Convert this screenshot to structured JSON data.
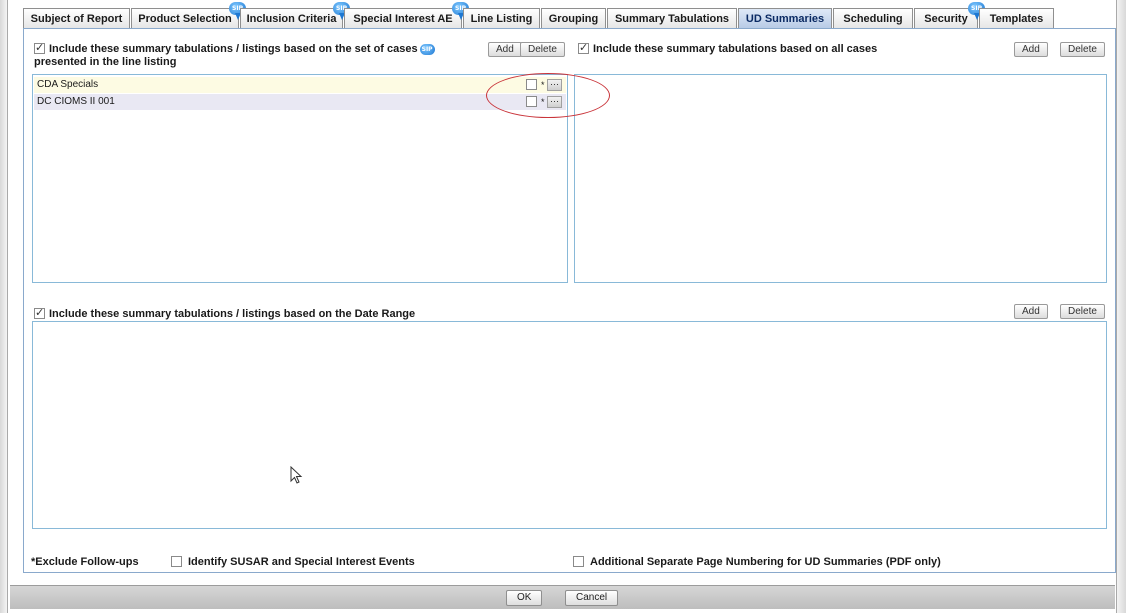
{
  "tabs": [
    {
      "label": "Subject of Report",
      "active": false,
      "badge": false
    },
    {
      "label": "Product Selection",
      "active": false,
      "badge": true
    },
    {
      "label": "Inclusion Criteria",
      "active": false,
      "badge": true
    },
    {
      "label": "Special Interest AE",
      "active": false,
      "badge": true
    },
    {
      "label": "Line Listing",
      "active": false,
      "badge": false
    },
    {
      "label": "Grouping",
      "active": false,
      "badge": false
    },
    {
      "label": "Summary Tabulations",
      "active": false,
      "badge": false
    },
    {
      "label": "UD Summaries",
      "active": true,
      "badge": false
    },
    {
      "label": "Scheduling",
      "active": false,
      "badge": false
    },
    {
      "label": "Security",
      "active": false,
      "badge": true
    },
    {
      "label": "Templates",
      "active": false,
      "badge": false
    }
  ],
  "badge_text": "SIP",
  "line_listing_section": {
    "checked": true,
    "label_line1": "Include these summary tabulations / listings based on the set of cases",
    "label_line2": "presented in the line listing",
    "add_label": "Add",
    "delete_label": "Delete",
    "rows": [
      {
        "name": "CDA Specials",
        "checked": false,
        "star": "*",
        "ellipsis": "···"
      },
      {
        "name": "DC CIOMS II 001",
        "checked": false,
        "star": "*",
        "ellipsis": "···"
      }
    ]
  },
  "all_cases_section": {
    "checked": true,
    "label": "Include these summary tabulations based on all cases",
    "add_label": "Add",
    "delete_label": "Delete"
  },
  "date_range_section": {
    "checked": true,
    "label": "Include these summary tabulations / listings based on the Date Range",
    "add_label": "Add",
    "delete_label": "Delete"
  },
  "options": {
    "exclude_followups": "*Exclude Follow-ups",
    "identify_susar": "Identify SUSAR and Special Interest Events",
    "identify_susar_checked": false,
    "separate_numbering": "Additional Separate Page Numbering for UD Summaries (PDF only)",
    "separate_numbering_checked": false
  },
  "footer": {
    "ok_label": "OK",
    "cancel_label": "Cancel"
  },
  "colors": {
    "active_tab": "#b8cbe6",
    "list_border": "#89b9d8",
    "row_highlight_1": "#fdfbe3",
    "row_highlight_2": "#e9e8f3",
    "annotation_red": "#c9343a"
  }
}
